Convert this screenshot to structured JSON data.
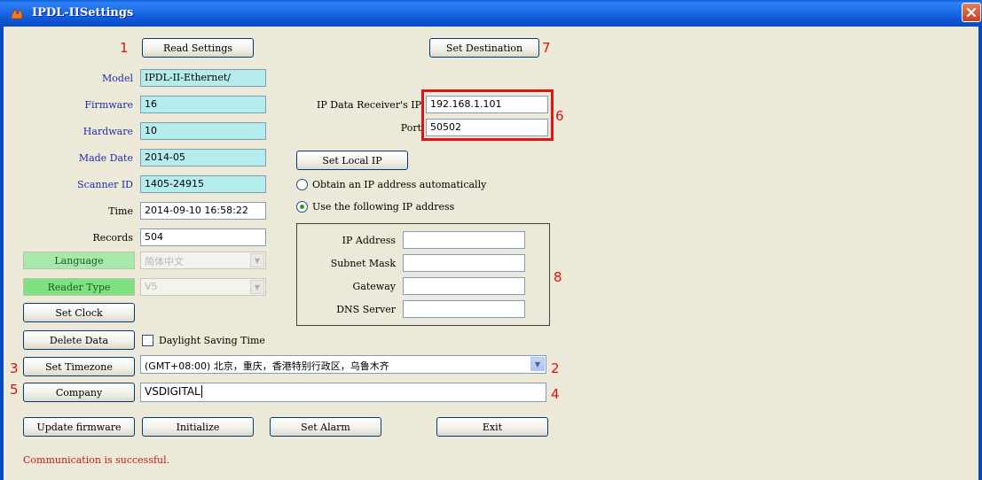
{
  "window": {
    "title": "IPDL-IISettings",
    "app_icon": "flame-icon",
    "close_icon": "close-icon"
  },
  "buttons": {
    "read_settings": "Read Settings",
    "set_destination": "Set Destination",
    "set_local_ip": "Set Local IP",
    "set_clock": "Set Clock",
    "delete_data": "Delete Data",
    "set_timezone": "Set Timezone",
    "company": "Company",
    "update_firmware": "Update firmware",
    "initialize": "Initialize",
    "set_alarm": "Set Alarm",
    "exit": "Exit"
  },
  "device_info": {
    "model_label": "Model",
    "model_value": "IPDL-II-Ethernet/",
    "firmware_label": "Firmware",
    "firmware_value": "16",
    "hardware_label": "Hardware",
    "hardware_value": "10",
    "made_date_label": "Made Date",
    "made_date_value": "2014-05",
    "scanner_id_label": "Scanner ID",
    "scanner_id_value": "1405-24915",
    "time_label": "Time",
    "time_value": "2014-09-10 16:58:22",
    "records_label": "Records",
    "records_value": "504",
    "language_label": "Language",
    "language_value": "简体中文",
    "reader_type_label": "Reader Type",
    "reader_type_value": "V5"
  },
  "destination": {
    "receiver_ip_label": "IP Data Receiver's IP",
    "receiver_ip_value": "192.168.1.101",
    "port_label": "Port",
    "port_value": "50502"
  },
  "local_ip": {
    "obtain_auto_label": "Obtain an IP address automatically",
    "obtain_auto_selected": false,
    "use_following_label": "Use the following IP address",
    "use_following_selected": true,
    "ip_address_label": "IP Address",
    "ip_address_value": "",
    "subnet_mask_label": "Subnet Mask",
    "subnet_mask_value": "",
    "gateway_label": "Gateway",
    "gateway_value": "",
    "dns_server_label": "DNS Server",
    "dns_server_value": ""
  },
  "daylight_saving": {
    "label": "Daylight Saving Time",
    "checked": false
  },
  "timezone": {
    "value": "(GMT+08:00) 北京，重庆，香港特别行政区，乌鲁木齐"
  },
  "company": {
    "value": "VSDIGITAL"
  },
  "status": {
    "text": "Communication is successful."
  },
  "annotations": {
    "m1": "1",
    "m2": "2",
    "m3": "3",
    "m4": "4",
    "m5": "5",
    "m6": "6",
    "m7": "7",
    "m8": "8"
  },
  "colors": {
    "title_bar": "#0a5fdd",
    "info_field": "#b5ecec",
    "label_blue": "#1a2fa8",
    "annotation_red": "#e01414",
    "status_text": "#c21a1a",
    "language_badge": "#a8e8a8",
    "reader_badge": "#7fe07f"
  }
}
